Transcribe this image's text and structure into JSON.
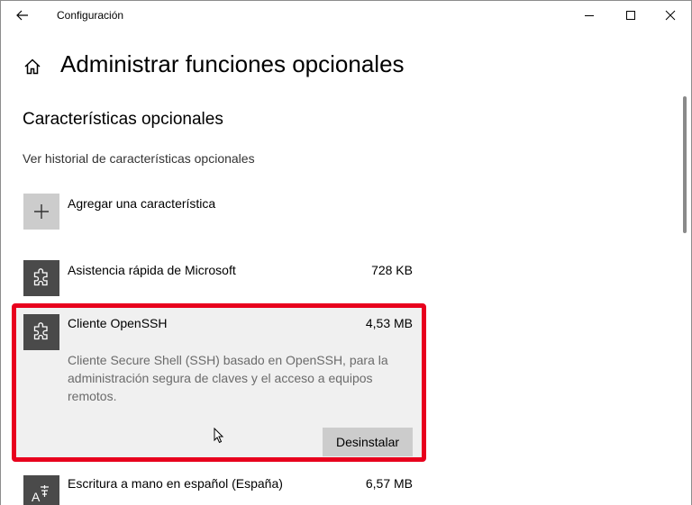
{
  "window": {
    "app_title": "Configuración",
    "minimize_symbol": "—",
    "maximize_symbol": "☐",
    "close_symbol": "✕"
  },
  "header": {
    "page_title": "Administrar funciones opcionales",
    "section_title": "Características opcionales",
    "history_link": "Ver historial de características opcionales"
  },
  "add_feature": {
    "label": "Agregar una característica",
    "icon": "plus-icon"
  },
  "features": [
    {
      "name": "Asistencia rápida de Microsoft",
      "size": "728 KB",
      "icon": "puzzle-icon"
    },
    {
      "name": "Cliente OpenSSH",
      "size": "4,53 MB",
      "icon": "puzzle-icon",
      "description": "Cliente Secure Shell (SSH) basado en OpenSSH, para la administración segura de claves y el acceso a equipos remotos.",
      "uninstall_label": "Desinstalar",
      "selected": true
    },
    {
      "name": "Escritura a mano en español (España)",
      "size": "6,57 MB",
      "icon": "handwriting-icon"
    }
  ],
  "colors": {
    "highlight": "#e8001d",
    "tile_dark": "#4a4a4a",
    "tile_light": "#cccccc",
    "selected_bg": "#f0f0f0"
  }
}
